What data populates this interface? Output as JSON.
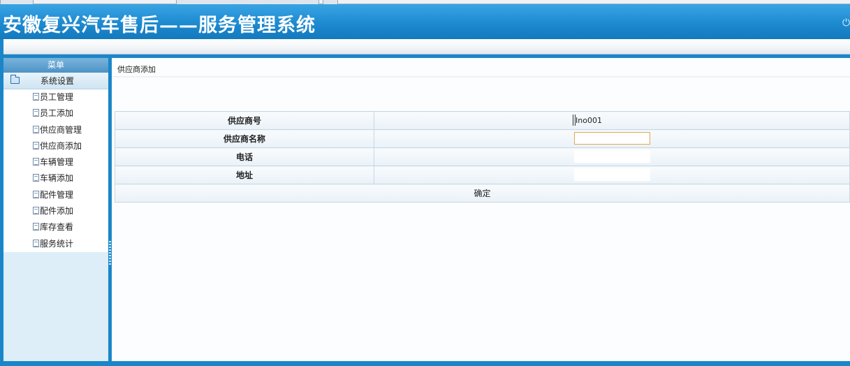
{
  "header": {
    "title": "安徽复兴汽车售后——服务管理系统",
    "power_icon": "power-icon"
  },
  "sidebar": {
    "menu_title": "菜单",
    "group": {
      "label": "系统设置",
      "icon": "folder-icon"
    },
    "items": [
      {
        "label": "员工管理",
        "icon": "document-icon"
      },
      {
        "label": "员工添加",
        "icon": "document-icon"
      },
      {
        "label": "供应商管理",
        "icon": "document-icon"
      },
      {
        "label": "供应商添加",
        "icon": "document-icon"
      },
      {
        "label": "车辆管理",
        "icon": "document-icon"
      },
      {
        "label": "车辆添加",
        "icon": "document-icon"
      },
      {
        "label": "配件管理",
        "icon": "document-icon"
      },
      {
        "label": "配件添加",
        "icon": "document-icon"
      },
      {
        "label": "库存查看",
        "icon": "document-icon"
      },
      {
        "label": "服务统计",
        "icon": "document-icon"
      }
    ]
  },
  "main": {
    "breadcrumb": "供应商添加",
    "form": {
      "fields": [
        {
          "label": "供应商号",
          "value": "Ino001"
        },
        {
          "label": "供应商名称",
          "value": ""
        },
        {
          "label": "电话",
          "value": ""
        },
        {
          "label": "地址",
          "value": ""
        }
      ],
      "submit_label": "确定"
    }
  },
  "colors": {
    "header_blue": "#1d8ad0",
    "input_focus_border": "#e0a84f",
    "sidebar_bg": "#ddeef8"
  }
}
